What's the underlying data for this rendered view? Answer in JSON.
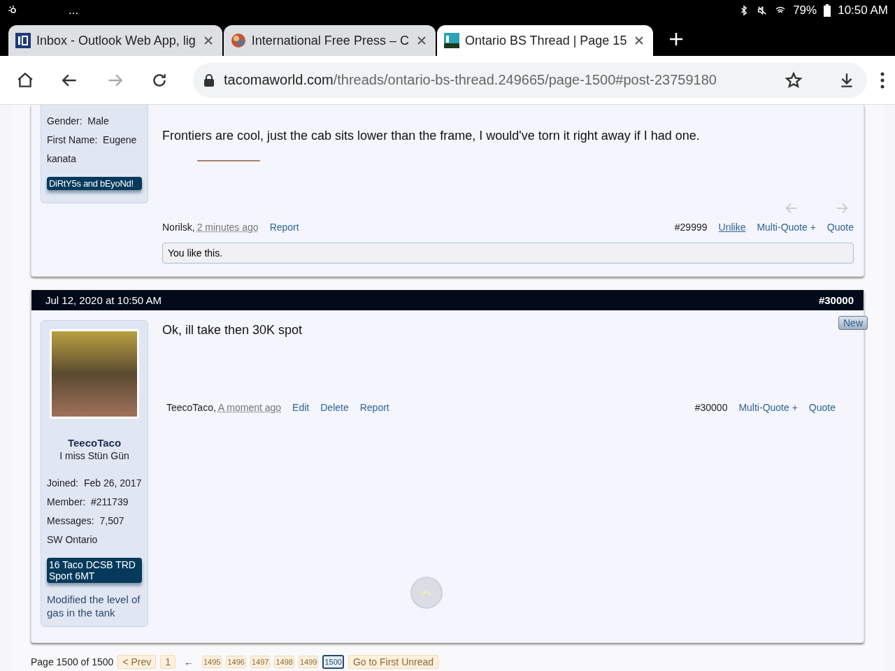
{
  "status_bar": {
    "battery": "79%",
    "time": "10:50 AM",
    "dots": "..."
  },
  "tabs": [
    {
      "title": "Inbox - Outlook Web App, lig",
      "selected": false
    },
    {
      "title": "International Free Press – C",
      "selected": false
    },
    {
      "title": "Ontario BS Thread | Page 15",
      "selected": true
    }
  ],
  "address_bar": {
    "domain": "tacomaworld.com",
    "path": "/threads/ontario-bs-thread.249665/page-1500#post-23759180"
  },
  "posts": [
    {
      "kind": "continued",
      "details": [
        "Gender:  Male",
        "First Name:  Eugene",
        "kanata"
      ],
      "banner": "DiRtY5s and bEyoNd!",
      "message": "Frontiers are cool, just the cab sits lower than the frame, I would've torn it right away if I had one.",
      "author": "Norilsk,",
      "time": "2 minutes ago",
      "left_actions": [
        {
          "label": "Report",
          "kind": "link"
        }
      ],
      "number": "#29999",
      "right_actions": [
        {
          "label": "Unlike",
          "kind": "underlined"
        },
        {
          "label": "Multi-Quote +",
          "kind": "link"
        },
        {
          "label": "Quote",
          "kind": "link"
        }
      ],
      "likes": "You like this."
    },
    {
      "kind": "full",
      "header": {
        "date": "Jul 12, 2020 at 10:50 AM",
        "number": "#30000"
      },
      "username": "TeecoTaco",
      "user_title": "I miss Stün Gün",
      "details": [
        "Joined:  Feb 26, 2017",
        "Member:  #211739",
        "Messages:  7,507",
        "SW Ontario"
      ],
      "banner": "16 Taco DCSB TRD Sport 6MT",
      "signature": "Modified the level of gas in the tank",
      "message": "Ok, ill take then 30K spot",
      "new_badge": "New",
      "author": "TeecoTaco,",
      "time": "A moment ago",
      "left_actions": [
        {
          "label": "Edit",
          "kind": "link"
        },
        {
          "label": "Delete",
          "kind": "link"
        },
        {
          "label": "Report",
          "kind": "link"
        }
      ],
      "number": "#30000",
      "right_actions": [
        {
          "label": "Multi-Quote +",
          "kind": "link"
        },
        {
          "label": "Quote",
          "kind": "link"
        }
      ]
    }
  ],
  "pagination": {
    "summary": "Page 1500 of 1500",
    "prev": "< Prev",
    "first": "1",
    "skip": "←",
    "pages": [
      {
        "label": "1495",
        "selected": false
      },
      {
        "label": "1496",
        "selected": false
      },
      {
        "label": "1497",
        "selected": false
      },
      {
        "label": "1498",
        "selected": false
      },
      {
        "label": "1499",
        "selected": false
      },
      {
        "label": "1500",
        "selected": true
      }
    ],
    "unread": "Go to First Unread"
  }
}
